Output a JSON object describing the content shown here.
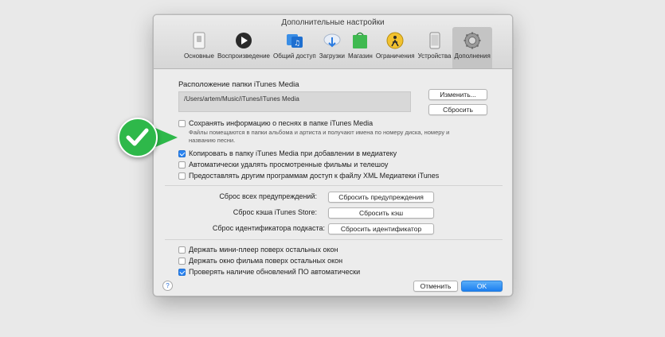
{
  "window": {
    "title": "Дополнительные настройки"
  },
  "toolbar": {
    "items": [
      {
        "label": "Основные",
        "icon": "switch-icon",
        "active": false
      },
      {
        "label": "Воспроизведение",
        "icon": "play-icon",
        "active": false
      },
      {
        "label": "Общий доступ",
        "icon": "share-icon",
        "active": false
      },
      {
        "label": "Загрузки",
        "icon": "download-icon",
        "active": false
      },
      {
        "label": "Магазин",
        "icon": "store-bag-icon",
        "active": false
      },
      {
        "label": "Ограничения",
        "icon": "parental-icon",
        "active": false
      },
      {
        "label": "Устройства",
        "icon": "device-icon",
        "active": false
      },
      {
        "label": "Дополнения",
        "icon": "gear-icon",
        "active": true
      }
    ]
  },
  "media_folder": {
    "heading": "Расположение папки iTunes Media",
    "path": "/Users/artem/Music/iTunes/iTunes Media",
    "change_button": "Изменить...",
    "reset_button": "Сбросить"
  },
  "options_top": [
    {
      "label": "Сохранять информацию о песнях в папке iTunes Media",
      "checked": false
    },
    {
      "label": "Копировать в папку iTunes Media при добавлении в медиатеку",
      "checked": true
    },
    {
      "label": "Автоматически удалять просмотренные фильмы и телешоу",
      "checked": false
    },
    {
      "label": "Предоставлять другим программам доступ к файлу XML Медиатеки iTunes",
      "checked": false
    }
  ],
  "hint_text": "Файлы помещаются в папки альбома и артиста и получают имена по номеру диска, номеру и названию песни.",
  "resets": [
    {
      "label": "Сброс всех предупреждений:",
      "button": "Сбросить предупреждения"
    },
    {
      "label": "Сброс кэша iTunes Store:",
      "button": "Сбросить кэш"
    },
    {
      "label": "Сброс идентификатора подкаста:",
      "button": "Сбросить идентификатор"
    }
  ],
  "options_bottom": [
    {
      "label": "Держать мини-плеер поверх остальных окон",
      "checked": false
    },
    {
      "label": "Держать окно фильма поверх остальных окон",
      "checked": false
    },
    {
      "label": "Проверять наличие обновлений ПО автоматически",
      "checked": true
    }
  ],
  "footer": {
    "help": "?",
    "cancel": "Отменить",
    "ok": "OK"
  },
  "colors": {
    "accent": "#2a84f2",
    "badge": "#2eb84a"
  }
}
